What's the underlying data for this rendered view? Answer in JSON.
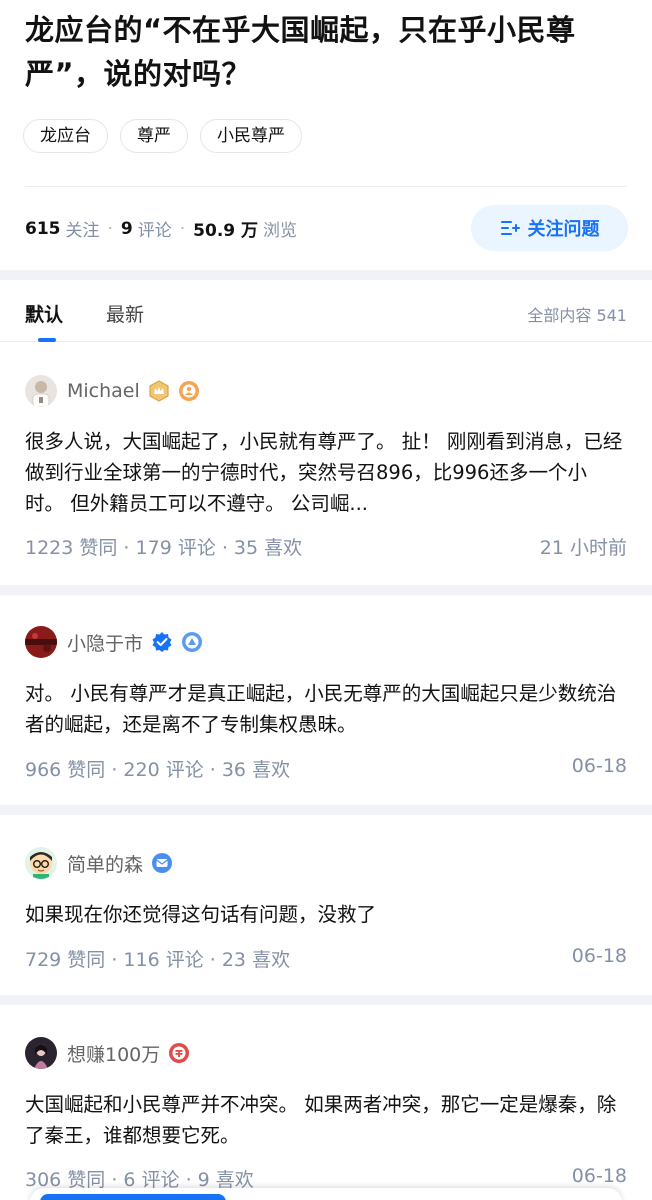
{
  "question": {
    "title": "龙应台的“不在乎大国崛起，只在乎小民尊严”，说的对吗？",
    "tags": [
      "龙应台",
      "尊严",
      "小民尊严"
    ],
    "follow_count": "615",
    "follow_label": "关注",
    "comment_count": "9",
    "comment_label": "评论",
    "view_count": "50.9 万",
    "view_label": "浏览",
    "follow_button": "关注问题"
  },
  "tabs": {
    "items": [
      "默认",
      "最新"
    ],
    "active": "默认",
    "total_label": "全部内容 541"
  },
  "answers": [
    {
      "author": "Michael",
      "badges": [
        "crown-badge-icon",
        "orange-medal-icon"
      ],
      "content": "很多人说，大国崛起了，小民就有尊严了。 扯！ 刚刚看到消息，已经做到行业全球第一的宁德时代，突然号召896，比996还多一个小时。 但外籍员工可以不遵守。 公司崛...",
      "stats": "1223  赞同 · 179  评论 · 35  喜欢",
      "time": "21 小时前"
    },
    {
      "author": "小隐于市",
      "badges": [
        "verified-badge-icon",
        "blue-level-icon"
      ],
      "content": "对。 小民有尊严才是真正崛起，小民无尊严的大国崛起只是少数统治者的崛起，还是离不了专制集权愚昧。",
      "stats": "966  赞同 · 220  评论 · 36  喜欢",
      "time": "06-18"
    },
    {
      "author": "简单的森",
      "badges": [
        "blue-message-badge-icon"
      ],
      "content": "如果现在你还觉得这句话有问题，没救了",
      "stats": "729  赞同 · 116  评论 · 23  喜欢",
      "time": "06-18"
    },
    {
      "author": "想赚100万",
      "badges": [
        "red-badge-icon"
      ],
      "content": "大国崛起和小民尊严并不冲突。 如果两者冲突，那它一定是爆秦，除了秦王，谁都想要它死。",
      "stats": "306  赞同 · 6  评论 · 9  喜欢",
      "time": "06-18"
    }
  ],
  "colors": {
    "accent": "#1772f6",
    "accent_bg": "#ebf5ff",
    "meta_text": "#8590a6",
    "separator": "#f0f2f7"
  }
}
